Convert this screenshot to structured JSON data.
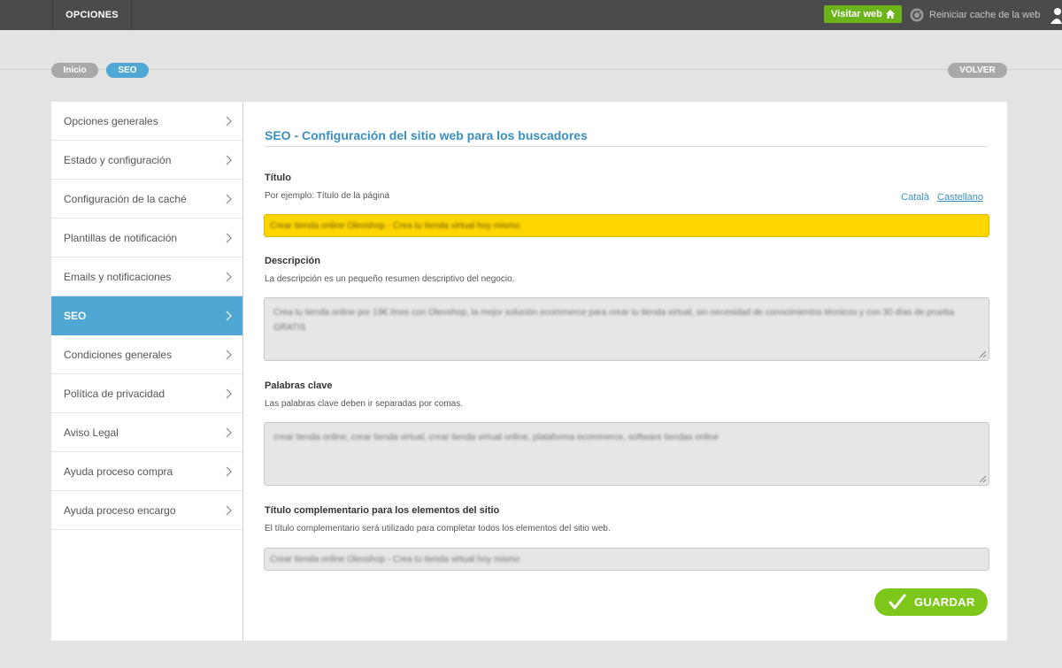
{
  "topbar": {
    "options_tab": "OPCIONES",
    "visit_web": "Visitar web",
    "reset_cache": "Reiniciar cache de la web",
    "icons": {
      "visit": "home-icon",
      "reset": "reload-icon"
    },
    "colors": {
      "bar": "#4b4b4b",
      "visit_button": "#6bb41a"
    }
  },
  "breadcrumb": {
    "items": [
      {
        "label": "Inicio"
      },
      {
        "label": "SEO"
      }
    ],
    "back_label": "VOLVER"
  },
  "sidebar": {
    "items": [
      {
        "label": "Opciones generales"
      },
      {
        "label": "Estado y configuración"
      },
      {
        "label": "Configuración de la caché"
      },
      {
        "label": "Plantillas de notificación"
      },
      {
        "label": "Emails y notificaciones"
      },
      {
        "label": "SEO",
        "active": true
      },
      {
        "label": "Condiciones generales"
      },
      {
        "label": "Política de privacidad"
      },
      {
        "label": "Aviso Legal"
      },
      {
        "label": "Ayuda proceso compra"
      },
      {
        "label": "Ayuda proceso encargo"
      }
    ],
    "active_color": "#4fa8d4"
  },
  "main": {
    "title": "SEO - Configuración del sitio web para los buscadores",
    "languages": [
      "Català",
      "Castellano"
    ],
    "fields": {
      "titulo": {
        "label": "Título",
        "hint": "Por ejemplo: Título de la página",
        "value": "Crear tienda online Oleoshop - Crea tu tienda virtual hoy mismo"
      },
      "descripcion": {
        "label": "Descripción",
        "hint": "La descripción es un pequeño resumen descriptivo del negocio.",
        "value": "Crea tu tienda online por 19€ /mes con Oleoshop, la mejor solución ecommerce para crear tu tienda virtual, sin necesidad de conocimientos técnicos y con 30 días de prueba GRATIS"
      },
      "palabras_clave": {
        "label": "Palabras clave",
        "hint": "Las palabras clave deben ir separadas por comas.",
        "value": "crear tienda online, crear tienda virtual, crear tienda virtual online, plataforma ecommerce, software tiendas online"
      },
      "titulo_complementario": {
        "label": "Título complementario para los elementos del sitio",
        "hint": "El título complementario será utilizado para completar todos los elementos del sitio web.",
        "value": "Crear tienda online Oleoshop - Crea tu tienda virtual hoy mismo"
      }
    },
    "save_label": "GUARDAR",
    "save_color": "#7dc61a",
    "title_color": "#3a8fc0"
  }
}
